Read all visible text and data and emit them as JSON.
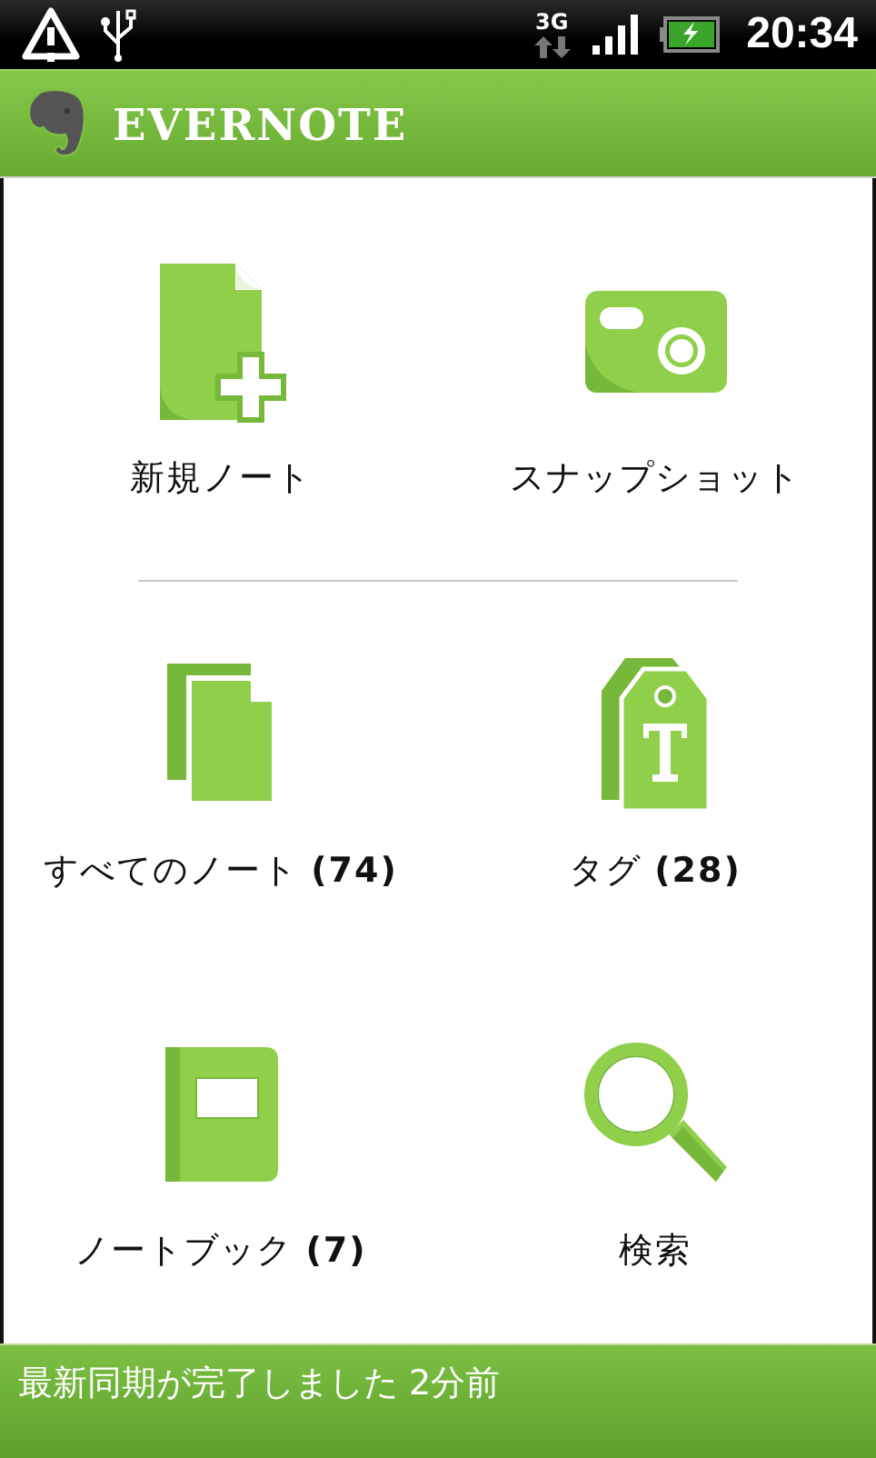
{
  "status_bar": {
    "network": "3G",
    "time": "20:34",
    "charging": true
  },
  "header": {
    "title": "EVERNOTE"
  },
  "tiles": [
    {
      "kind": "new-note",
      "label": "新規ノート"
    },
    {
      "kind": "snapshot",
      "label": "スナップショット"
    },
    {
      "kind": "all-notes",
      "label": "すべてのノート **(74)**"
    },
    {
      "kind": "tags",
      "label": "タグ **(28)**"
    },
    {
      "kind": "notebooks",
      "label": "ノートブック **(7)**"
    },
    {
      "kind": "search",
      "label": "検索"
    }
  ],
  "sync_bar": {
    "text": "最新同期が完了しました 2分前"
  }
}
